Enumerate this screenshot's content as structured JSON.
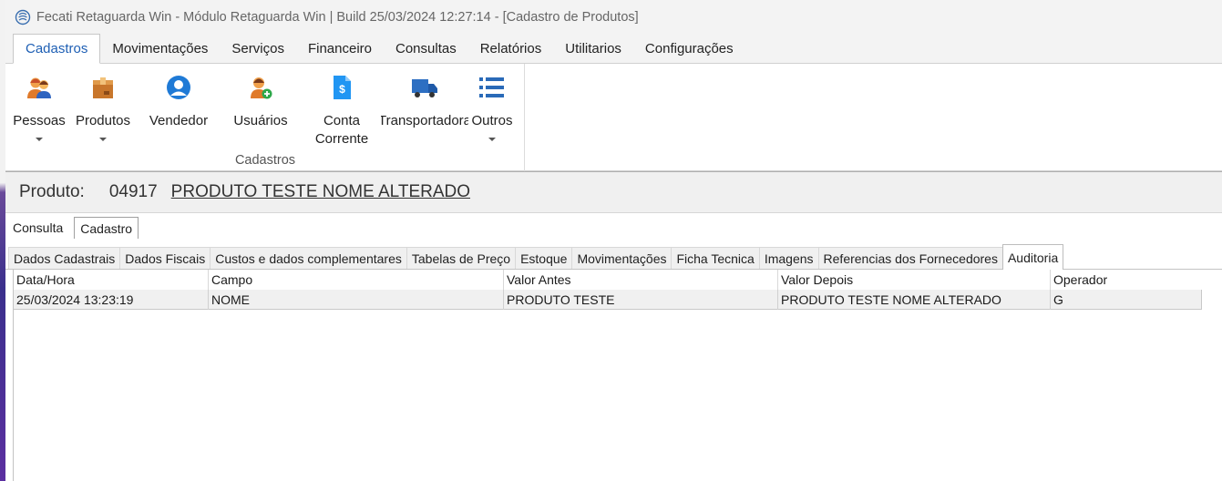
{
  "window": {
    "title": "Fecati Retaguarda Win - Módulo Retaguarda Win  |  Build 25/03/2024 12:27:14 - [Cadastro de Produtos]"
  },
  "menu": {
    "tabs": [
      "Cadastros",
      "Movimentações",
      "Serviços",
      "Financeiro",
      "Consultas",
      "Relatórios",
      "Utilitarios",
      "Configurações"
    ],
    "active": "Cadastros"
  },
  "ribbon": {
    "group_label": "Cadastros",
    "buttons": [
      {
        "label": "Pessoas",
        "icon": "people-icon"
      },
      {
        "label": "Produtos",
        "icon": "box-icon"
      },
      {
        "label": "Vendedor",
        "icon": "user-circle-icon"
      },
      {
        "label": "Usuários",
        "icon": "user-add-icon"
      },
      {
        "label": "Conta\nCorrente",
        "label_line1": "Conta",
        "label_line2": "Corrente",
        "icon": "dollar-document-icon"
      },
      {
        "label": "Transportadora",
        "icon": "truck-icon"
      },
      {
        "label": "Outros",
        "icon": "list-icon"
      }
    ]
  },
  "produto": {
    "label": "Produto:",
    "code": "04917",
    "name": "PRODUTO TESTE NOME ALTERADO"
  },
  "subtabs": [
    "Consulta",
    "Cadastro"
  ],
  "pagetabs": [
    "Dados Cadastrais",
    "Dados Fiscais",
    "Custos e dados complementares",
    "Tabelas de Preço",
    "Estoque",
    "Movimentações",
    "Ficha Tecnica",
    "Imagens",
    "Referencias dos Fornecedores",
    "Auditoria"
  ],
  "audit_grid": {
    "columns": [
      "Data/Hora",
      "Campo",
      "Valor Antes",
      "Valor Depois",
      "Operador"
    ],
    "rows": [
      [
        "25/03/2024 13:23:19",
        "NOME",
        "PRODUTO TESTE",
        "PRODUTO TESTE NOME ALTERADO",
        "G"
      ]
    ]
  },
  "colors": {
    "accent": "#1e5fb4",
    "chrome": "#f3f3f3",
    "people_icon": "#e07a2a",
    "box_icon": "#c8762b",
    "vendedor_icon": "#1f7ad6",
    "doc_icon": "#2196f3",
    "truck_icon": "#2d6fc2",
    "list_icon": "#2a6ab8"
  }
}
